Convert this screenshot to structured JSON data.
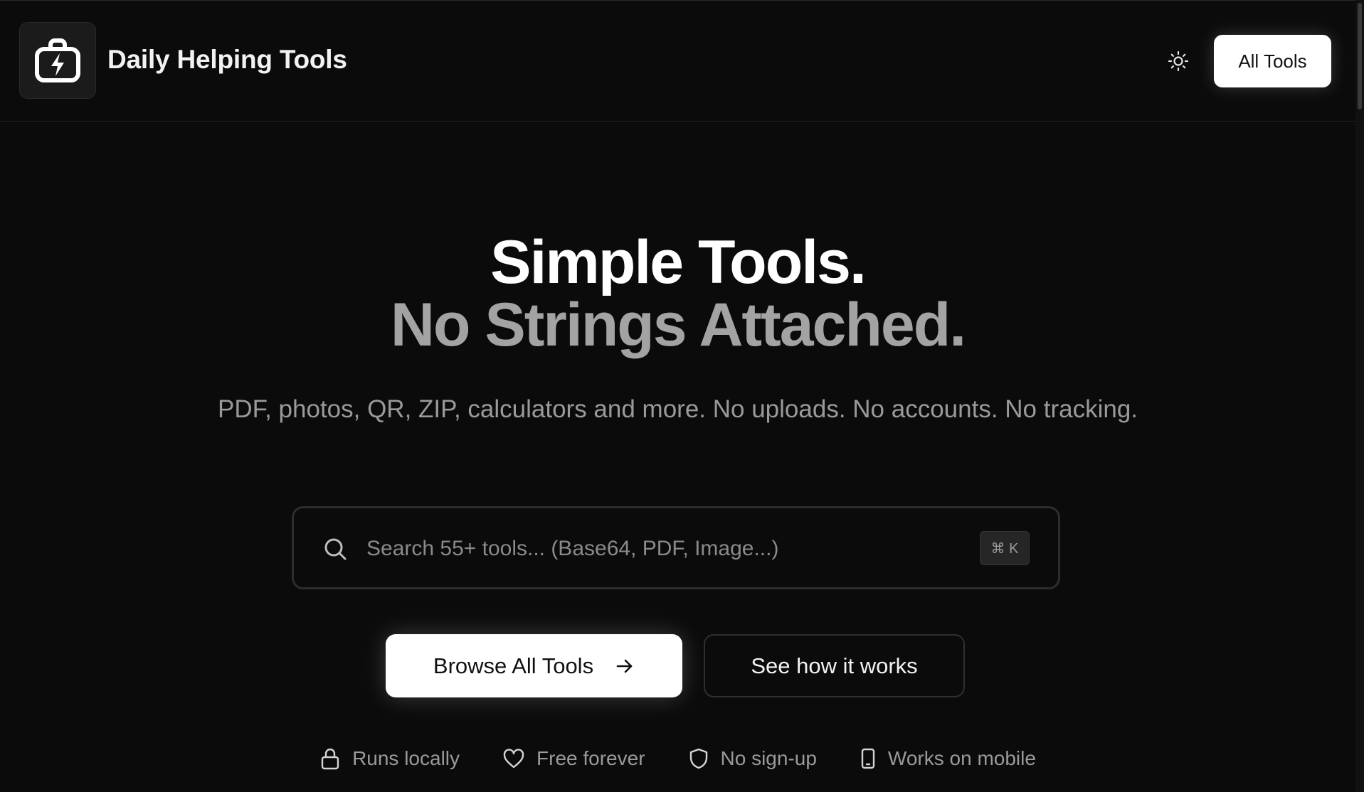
{
  "header": {
    "brand_name": "Daily Helping Tools",
    "all_tools_label": "All Tools"
  },
  "hero": {
    "title_line1": "Simple Tools.",
    "title_line2": "No Strings Attached.",
    "subtitle": "PDF, photos, QR, ZIP, calculators and more. No uploads. No accounts. No tracking."
  },
  "search": {
    "placeholder": "Search 55+ tools... (Base64, PDF, Image...)",
    "value": "",
    "shortcut": "⌘ K"
  },
  "actions": {
    "browse_label": "Browse All Tools",
    "see_how_label": "See how it works"
  },
  "features": [
    {
      "icon": "lock-icon",
      "label": "Runs locally"
    },
    {
      "icon": "heart-icon",
      "label": "Free forever"
    },
    {
      "icon": "shield-icon",
      "label": "No sign-up"
    },
    {
      "icon": "smartphone-icon",
      "label": "Works on mobile"
    }
  ],
  "colors": {
    "background": "#0b0b0b",
    "title_primary": "#ffffff",
    "title_secondary": "#a3a3a3",
    "muted_text": "#9a9a9a",
    "button_primary_bg": "#ffffff"
  }
}
